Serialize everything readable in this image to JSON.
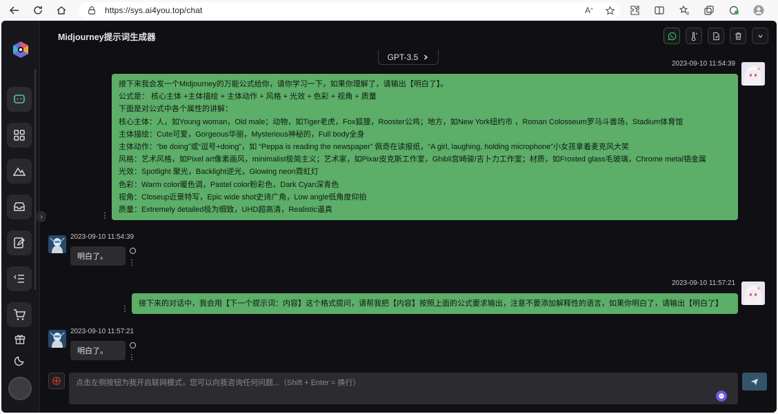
{
  "browser": {
    "url": "https://sys.ai4you.top/chat"
  },
  "app": {
    "title": "Midjourney提示词生成器",
    "model": "GPT-3.5"
  },
  "messages": [
    {
      "role": "user",
      "timestamp": "2023-09-10 11:54:39",
      "lines": [
        "接下来我会发一个Midjourney的万能公式给你，请你学习一下，如果你理解了，请输出【明白了】。",
        "公式是： 核心主体 +主体描绘 + 主体动作 + 风格 + 光效 + 色彩 + 视角 + 质量",
        "下面是对公式中各个属性的讲解：",
        "核心主体：人，如Young woman，Old male；动物，如Tiger老虎，Fox狐狸，Rooster公鸡；地方，如New York纽约市 ，Roman Colosseum罗马斗兽场，Stadium体育馆",
        "主体描绘：Cute可爱，Gorgeous华丽，Mysterious神秘的，Full body全身",
        "主体动作：“be doing”或“逗号+doing”，如 “Peppa is reading the newspaper” 佩奇在读报纸，“A girl, laughing, holding microphone”小女孩拿着麦克风大笑",
        "风格：艺术风格，如Pixel art像素画风，minimalist极简主义；艺术家，如Pixar皮克斯工作室，Ghibli宫崎骏/吉卜力工作室；材质，如Frosted glass毛玻璃，Chrome metal铬金属",
        "光效：Spotlight 聚光，Backlight逆光，Glowing neon霓虹灯",
        "色彩：Warm color暖色调，Pastel color粉彩色，Dark Cyan深青色",
        "视角：Closeup近景特写，Epic wide shot史诗广角，Low angle低角度仰拍",
        "质量：Extremely detailed极为细致，UHD超高清，Realistic逼真"
      ]
    },
    {
      "role": "bot",
      "timestamp": "2023-09-10 11:54:39",
      "text": "明白了。"
    },
    {
      "role": "user",
      "timestamp": "2023-09-10 11:57:21",
      "lines": [
        "接下来的对话中，我会用【下一个提示词：内容】这个格式提问，请帮我把【内容】按照上面的公式要求输出，注意不要添加解释性的语言，如果你明白了，请输出【明白了】"
      ]
    },
    {
      "role": "bot",
      "timestamp": "2023-09-10 11:57:21",
      "text": "明白了。"
    }
  ],
  "input": {
    "placeholder": "点击左侧按钮为我开启联网模式，您可以向我咨询任何问题...（Shift + Enter = 换行）"
  }
}
